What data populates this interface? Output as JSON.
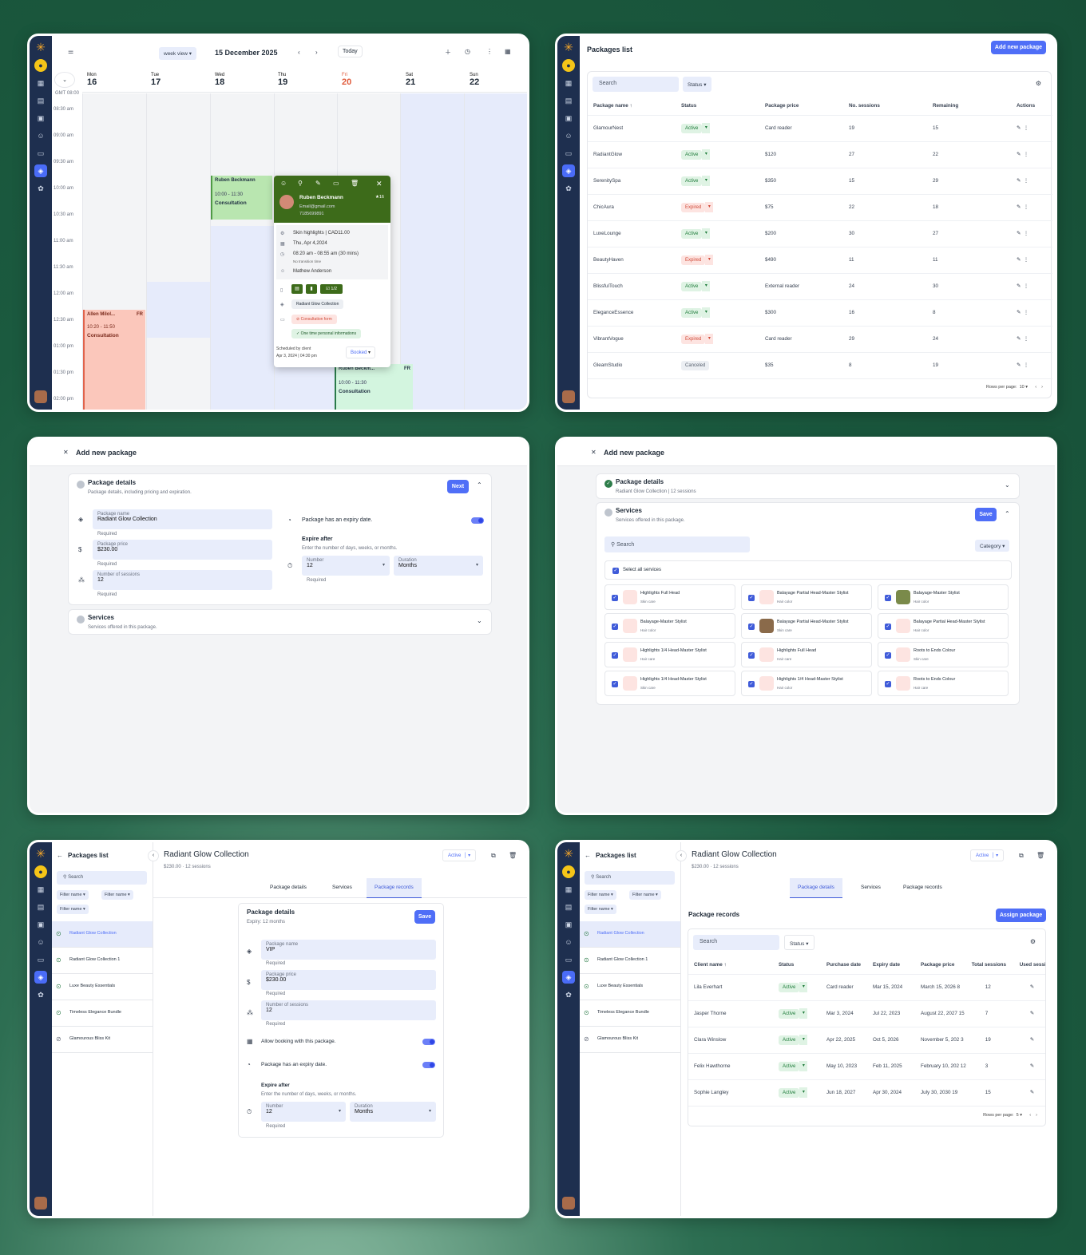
{
  "cal": {
    "view": "week view",
    "date": "15 December 2025",
    "today": "Today",
    "tz": "GMT 08:00",
    "days": [
      {
        "d": "Mon",
        "n": "16"
      },
      {
        "d": "Tue",
        "n": "17"
      },
      {
        "d": "Wed",
        "n": "18"
      },
      {
        "d": "Thu",
        "n": "19"
      },
      {
        "d": "Fri",
        "n": "20"
      },
      {
        "d": "Sat",
        "n": "21"
      },
      {
        "d": "Sun",
        "n": "22"
      }
    ],
    "times": [
      "08:30 am",
      "09:00 am",
      "09:30 am",
      "10:00 am",
      "10:30 am",
      "11:00 am",
      "11:30 am",
      "12:00 am",
      "12:30 am",
      "01:00 pm",
      "01:30 pm",
      "02:00 pm"
    ],
    "ev1": {
      "name": "Ruben Beckmann",
      "time": "10:00 - 11:30",
      "type": "Consultation"
    },
    "ev2": {
      "name": "Allen Milol...",
      "tag": "FR",
      "time": "10:20 - 11:50",
      "type": "Consultation"
    },
    "ev3": {
      "name": "Ruben Beckm...",
      "tag": "FR",
      "time": "10:00 - 11:30",
      "type": "Consultation"
    },
    "pop": {
      "name": "Ruben Beckmann",
      "rating": "★16",
      "email": "Email@gmail.com",
      "phone": "7185699891",
      "service": "Skin highlights | CAD11.00",
      "date": "Thu, Apr 4,2024",
      "time": "08:20 am - 08:55 am (30 mins)",
      "trans": "No transition time",
      "staff": "Mathew Anderson",
      "count": "1/2",
      "pkg": "Radiant Glow Collection",
      "form": "Consultation form",
      "info": "One time personal informations",
      "sched": "Scheduled by client",
      "sdate": "Apr 3, 2024 | 04:30 pm",
      "status": "Booked"
    }
  },
  "plist": {
    "title": "Packages list",
    "add": "Add new package",
    "search": "Search",
    "status": "Status",
    "cols": [
      "Package name",
      "Status",
      "Package price",
      "No. sessions",
      "Remaining",
      "Actions"
    ],
    "rows": [
      [
        "GlamourNest",
        "Active",
        "Card reader",
        "19",
        "15"
      ],
      [
        "RadiantGlow",
        "Active",
        "$120",
        "27",
        "22"
      ],
      [
        "SerenitySpa",
        "Active",
        "$350",
        "15",
        "29"
      ],
      [
        "ChicAura",
        "Expired",
        "$75",
        "22",
        "18"
      ],
      [
        "LuxeLounge",
        "Active",
        "$200",
        "30",
        "27"
      ],
      [
        "BeautyHaven",
        "Expired",
        "$490",
        "11",
        "11"
      ],
      [
        "BlissfulTouch",
        "Active",
        "External reader",
        "24",
        "30"
      ],
      [
        "EleganceEssence",
        "Active",
        "$300",
        "16",
        "8"
      ],
      [
        "VibrantVogue",
        "Expired",
        "Card reader",
        "29",
        "24"
      ],
      [
        "GleamStudio",
        "Canceled",
        "$35",
        "8",
        "19"
      ]
    ],
    "rpp": "Rows per page:",
    "rppv": "10"
  },
  "add1": {
    "title": "Add new package",
    "sec": "Package details",
    "secsub": "Package details, including pricing and expiration.",
    "next": "Next",
    "nameL": "Package name",
    "nameV": "Radiant Glow Collection",
    "req": "Required",
    "priceL": "Package price",
    "priceV": "$230.00",
    "sesL": "Number of sessions",
    "sesV": "12",
    "expiry": "Package has an expiry date.",
    "expAfter": "Expire after",
    "expSub": "Enter the number of days, weeks, or months.",
    "numL": "Number",
    "numV": "12",
    "durL": "Duration",
    "durV": "Months",
    "svc": "Services",
    "svcsub": "Services offered in this package."
  },
  "add2": {
    "title": "Add new package",
    "sec": "Package details",
    "secsub": "Radiant Glow Collection | 12 sessions",
    "svc": "Services",
    "svcsub": "Services offered in this package.",
    "save": "Save",
    "search": "Search",
    "cat": "Category",
    "selall": "Select all services",
    "items": [
      [
        "Highlights Full Head",
        "Skin care"
      ],
      [
        "Balayage Partial Head-Master Stylist",
        "Hair color"
      ],
      [
        "Balayage-Master Stylist",
        "Hair color"
      ],
      [
        "Balayage-Master Stylist",
        "Hair color"
      ],
      [
        "Balayage Partial Head-Master Stylist",
        "Skin care"
      ],
      [
        "Balayage Partial Head-Master Stylist",
        "Hair color"
      ],
      [
        "Highlights 1/4 Head-Master Stylist",
        "Hair care"
      ],
      [
        "Highlights Full Head",
        "Hair care"
      ],
      [
        "Roots to Ends Colour",
        "Skin care"
      ],
      [
        "Highlights 1/4 Head-Master Stylist",
        "Skin care"
      ],
      [
        "Highlights 1/4 Head-Master Stylist",
        "Hair color"
      ],
      [
        "Roots to Ends Colour",
        "Hair care"
      ]
    ]
  },
  "det": {
    "back": "Packages list",
    "search": "Search",
    "f1": "Filter name",
    "list": [
      "Radiant Glow Collection",
      "Radiant Glow Collection 1",
      "Luxe Beauty Essentials",
      "Timeless Elegance Bundle",
      "Glamourous Bliss Kit"
    ],
    "title": "Radiant Glow Collection",
    "sub": "$230.00  ·  12 sessions",
    "status": "Active",
    "tabs": [
      "Package details",
      "Services",
      "Package records"
    ],
    "card": "Package details",
    "expiry": "Expiry: 12 months",
    "save": "Save",
    "nameL": "Package name",
    "nameV": "VIP",
    "req": "Required",
    "priceL": "Package price",
    "priceV": "$230.00",
    "sesL": "Number of sessions",
    "sesV": "12",
    "allow": "Allow booking with this package.",
    "has": "Package has an expiry date.",
    "expAfter": "Expire after",
    "expSub": "Enter the number of days, weeks, or months.",
    "numL": "Number",
    "numV": "12",
    "durL": "Duration",
    "durV": "Months"
  },
  "rec": {
    "title": "Package records",
    "assign": "Assign package",
    "search": "Search",
    "status": "Status",
    "cols": [
      "Client name",
      "Status",
      "Purchase date",
      "Expiry date",
      "Package price",
      "Total sessions",
      "Used sessio"
    ],
    "rows": [
      [
        "Lila Everhart",
        "Active",
        "Card reader",
        "Mar 15, 2024",
        "March 15, 2026",
        "8",
        "12"
      ],
      [
        "Jasper Thorne",
        "Active",
        "Mar 3, 2024",
        "Jul 22, 2023",
        "August 22, 2027",
        "15",
        "7"
      ],
      [
        "Clara Winslow",
        "Active",
        "Apr 22, 2025",
        "Oct 5, 2026",
        "November 5, 202",
        "3",
        "19"
      ],
      [
        "Felix Hawthorne",
        "Active",
        "May 10, 2023",
        "Feb 11, 2025",
        "February 10, 202",
        "12",
        "3"
      ],
      [
        "Sophie Langley",
        "Active",
        "Jun 18, 2027",
        "Apr 30, 2024",
        "July 30, 2030",
        "19",
        "15"
      ]
    ],
    "rpp": "Rows per page:",
    "rppv": "5"
  }
}
